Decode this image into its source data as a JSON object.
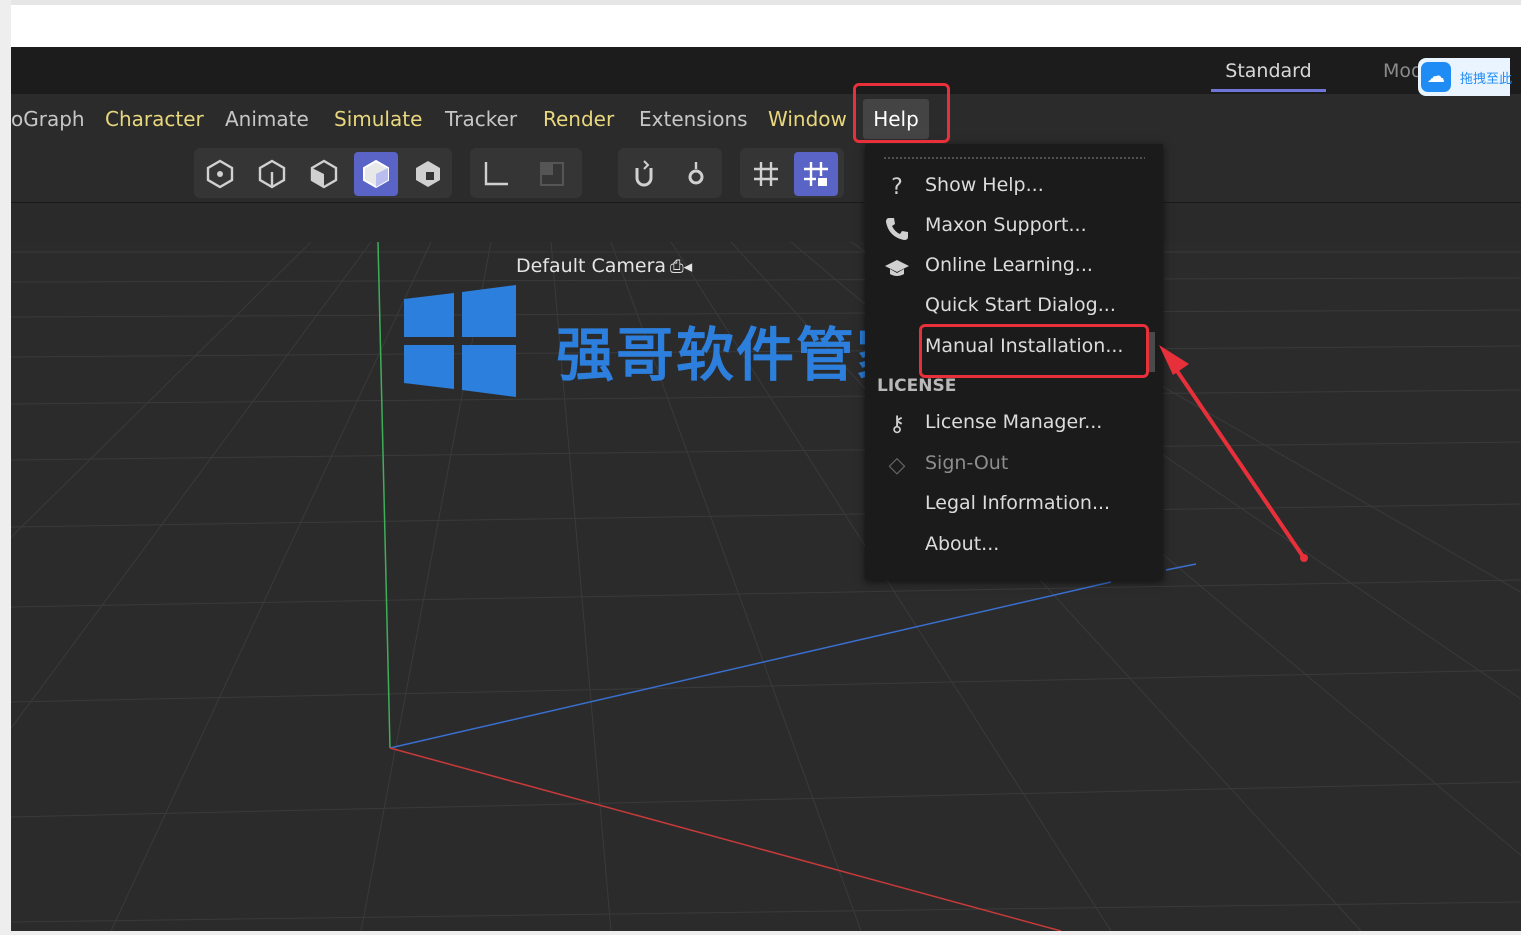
{
  "layout_tabs": [
    {
      "label": "Standard",
      "active": true
    },
    {
      "label": "Mod",
      "active": false
    }
  ],
  "cloud_overlay": {
    "label": "拖拽至此"
  },
  "menu_bar": {
    "items": [
      "oGraph",
      "Character",
      "Animate",
      "Simulate",
      "Tracker",
      "Render",
      "Extensions",
      "Window",
      "Help"
    ],
    "active": "Help"
  },
  "toolbar": {
    "buttons": [
      "object-mode-icon",
      "points-mode-icon",
      "edges-mode-icon",
      "polygons-mode-icon",
      "uvw-mode-icon",
      "axis-icon",
      "solo-icon",
      "snap-icon",
      "snap-settings-icon",
      "workplane-icon",
      "workplane-lock-icon"
    ]
  },
  "viewport": {
    "camera_label": "Default Camera"
  },
  "watermark": {
    "text": "强哥软件管家"
  },
  "help_menu": {
    "items": [
      {
        "label": "Show Help...",
        "icon": "question-icon",
        "enabled": true
      },
      {
        "label": "Maxon Support...",
        "icon": "phone-icon",
        "enabled": true
      },
      {
        "label": "Online Learning...",
        "icon": "graduation-cap-icon",
        "enabled": true
      },
      {
        "label": "Quick Start Dialog...",
        "icon": "",
        "enabled": true
      },
      {
        "label": "Manual Installation...",
        "icon": "",
        "enabled": true
      }
    ],
    "license_section": "LICENSE",
    "license_items": [
      {
        "label": "License Manager...",
        "icon": "key-icon",
        "enabled": true
      },
      {
        "label": "Sign-Out",
        "icon": "sign-out-icon",
        "enabled": false
      },
      {
        "label": "Legal Information...",
        "icon": "",
        "enabled": true
      },
      {
        "label": "About...",
        "icon": "",
        "enabled": true
      }
    ]
  },
  "colors": {
    "highlight": "#e8303a",
    "accent": "#5a63c6",
    "menu_yellow": "#e8d77c",
    "axis_x": "#c83a3a",
    "axis_y": "#3fae5a",
    "axis_z": "#3a6fd0"
  }
}
